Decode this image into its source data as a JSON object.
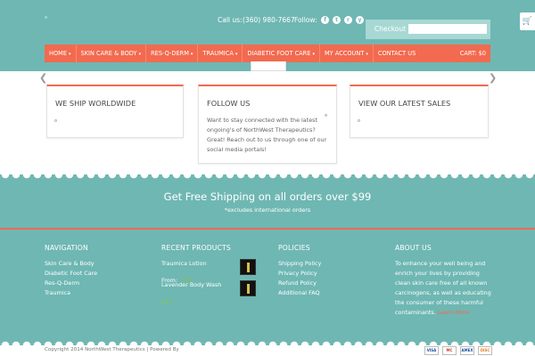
{
  "header": {
    "contact_label": "Call us:",
    "phone": "(360) 980-7667",
    "follow_label": "Follow:",
    "social_icons": [
      "facebook-icon",
      "twitter-icon",
      "rss-icon",
      "youtube-icon"
    ],
    "checkout_label": "Checkout",
    "search_placeholder": ""
  },
  "nav": {
    "items": [
      {
        "label": "HOME",
        "dropdown": true
      },
      {
        "label": "SKIN CARE & BODY",
        "dropdown": true
      },
      {
        "label": "RES-Q-DERM",
        "dropdown": true
      },
      {
        "label": "TRAUMICA",
        "dropdown": true
      },
      {
        "label": "DIABETIC FOOT CARE",
        "dropdown": true
      },
      {
        "label": "MY ACCOUNT",
        "dropdown": true
      },
      {
        "label": "CONTACT US",
        "dropdown": false
      }
    ],
    "cart_label": "CART:",
    "cart_value": "$0"
  },
  "boxes": [
    {
      "title": "WE SHIP WORLDWIDE",
      "text": ""
    },
    {
      "title": "FOLLOW US",
      "text": "Want to stay connected with the latest ongoing's of NorthWest Therapeutics? Great! Reach out to us through one of our social media portals!"
    },
    {
      "title": "VIEW OUR LATEST SALES",
      "text": ""
    }
  ],
  "shipping": {
    "title": "Get Free Shipping on all orders over $99",
    "subtitle": "*excludes international orders"
  },
  "footer": {
    "navigation": {
      "heading": "NAVIGATION",
      "links": [
        "Skin Care & Body",
        "Diabetic Foot Care",
        "Res-Q-Derm",
        "Traumica"
      ]
    },
    "recent_products": {
      "heading": "RECENT PRODUCTS",
      "items": [
        {
          "name": "Traumica Lotion",
          "price_prefix": "From:",
          "price": "$15"
        },
        {
          "name": "Lavender Body Wash",
          "price_prefix": "",
          "price": "$12"
        }
      ]
    },
    "policies": {
      "heading": "POLICIES",
      "links": [
        "Shipping Policy",
        "Privacy Policy",
        "Refund Policy",
        "Additional FAQ"
      ]
    },
    "about": {
      "heading": "ABOUT US",
      "text": "To enhance your well being and enrich your lives by providing clean skin care free of all known carcinogens, as well as educating the consumer of these harmful contaminants.",
      "link": "Learn More"
    }
  },
  "bottom": {
    "copyright": "Copyright 2014 NorthWest Therapeutics | Powered By",
    "cards": [
      "VISA",
      "MC",
      "AMEX",
      "DISC"
    ]
  },
  "colors": {
    "teal": "#6fb7b3",
    "coral": "#f26a4f",
    "white": "#ffffff"
  }
}
